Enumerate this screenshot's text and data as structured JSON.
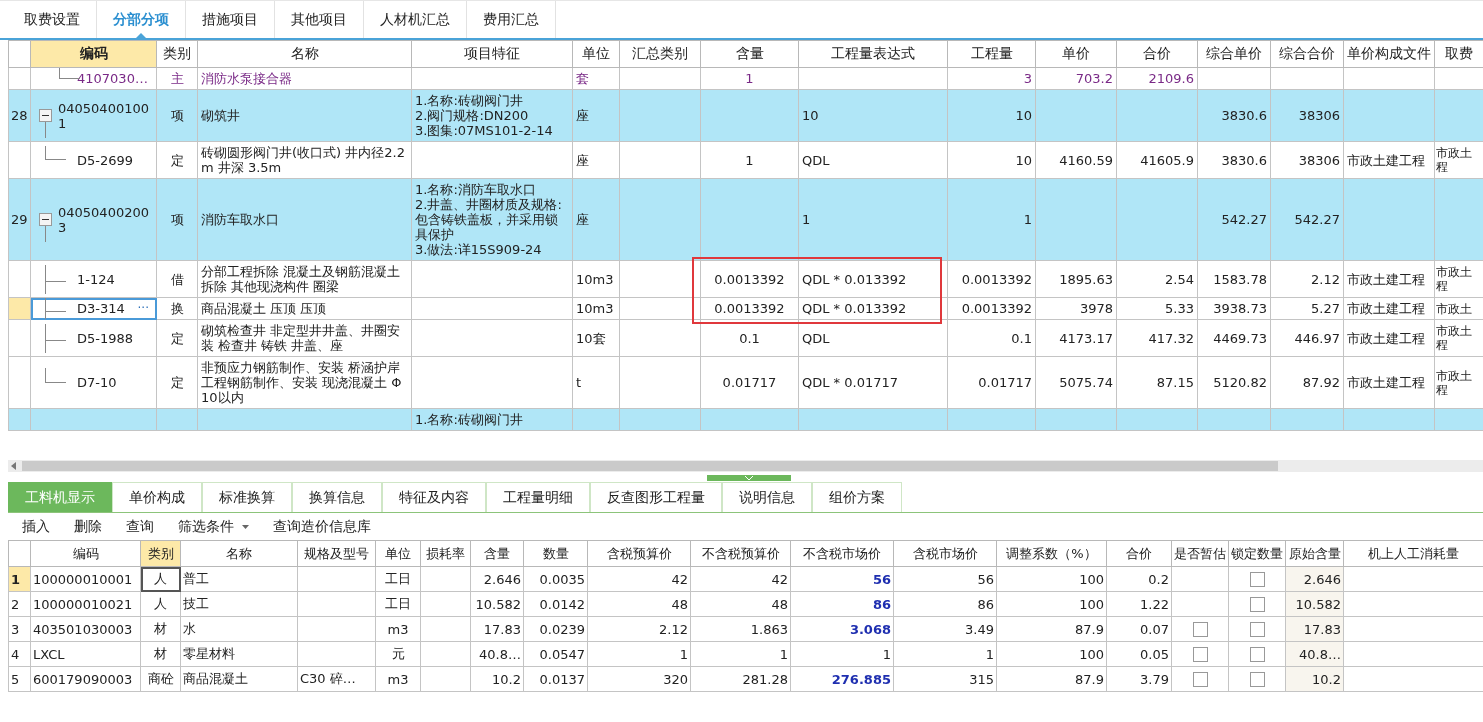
{
  "top_tabs": [
    {
      "label": "取费设置",
      "selected": false
    },
    {
      "label": "分部分项",
      "selected": true
    },
    {
      "label": "措施项目",
      "selected": false
    },
    {
      "label": "其他项目",
      "selected": false
    },
    {
      "label": "人材机汇总",
      "selected": false
    },
    {
      "label": "费用汇总",
      "selected": false
    }
  ],
  "grid": {
    "columns": [
      {
        "label": "编码",
        "selected": true
      },
      {
        "label": "类别",
        "selected": false
      },
      {
        "label": "名称",
        "selected": false
      },
      {
        "label": "项目特征",
        "selected": false
      },
      {
        "label": "单位",
        "selected": false
      },
      {
        "label": "汇总类别",
        "selected": false
      },
      {
        "label": "含量",
        "selected": false
      },
      {
        "label": "工程量表达式",
        "selected": false
      },
      {
        "label": "工程量",
        "selected": false
      },
      {
        "label": "单价",
        "selected": false
      },
      {
        "label": "合价",
        "selected": false
      },
      {
        "label": "综合单价",
        "selected": false
      },
      {
        "label": "综合合价",
        "selected": false
      },
      {
        "label": "单价构成文件",
        "selected": false
      },
      {
        "label": "取费",
        "selected": false
      }
    ],
    "rows": [
      {
        "kind": "material",
        "selected": false,
        "code": "4107030…",
        "type": "主",
        "name": "消防水泵接合器",
        "unit": "套",
        "qty": "1",
        "amount": "3",
        "price": "703.2",
        "total": "2109.6"
      },
      {
        "kind": "item",
        "number": "28",
        "expanded": true,
        "selected": false,
        "code": "040504001001",
        "type": "项",
        "name": "砌筑井",
        "feature": "1.名称:砖砌阀门井\n2.阀门规格:DN200\n3.图集:07MS101-2-14",
        "unit": "座",
        "expr": "10",
        "amount": "10",
        "comp_price": "3830.6",
        "comp_total": "38306",
        "children": [
          {
            "kind": "quota",
            "selected": false,
            "code": "D5-2699",
            "type": "定",
            "name": "砖砌圆形阀门井(收口式) 井内径2.2m 井深 3.5m",
            "unit": "座",
            "qty": "1",
            "expr": "QDL",
            "amount": "10",
            "price": "4160.59",
            "total": "41605.9",
            "comp_price": "3830.6",
            "comp_total": "38306",
            "file": "市政土建工程",
            "fee": "市政土程"
          }
        ]
      },
      {
        "kind": "item",
        "number": "29",
        "expanded": true,
        "selected": false,
        "code": "040504002003",
        "type": "项",
        "name": "消防车取水口",
        "feature": "1.名称:消防车取水口\n2.井盖、井圈材质及规格:包含铸铁盖板，并采用锁具保护\n3.做法:详15S909-24",
        "unit": "座",
        "expr": "1",
        "amount": "1",
        "comp_price": "542.27",
        "comp_total": "542.27",
        "children": [
          {
            "kind": "quota",
            "selected": false,
            "highlighted": true,
            "code": "1-124",
            "type": "借",
            "name": "分部工程拆除 混凝土及钢筋混凝土拆除 其他现浇构件 圈梁",
            "unit": "10m3",
            "qty": "0.0013392",
            "expr": "QDL * 0.013392",
            "amount": "0.0013392",
            "price": "1895.63",
            "total": "2.54",
            "comp_price": "1583.78",
            "comp_total": "2.12",
            "file": "市政土建工程",
            "fee": "市政土程"
          },
          {
            "kind": "quota",
            "selected": true,
            "highlighted": true,
            "code": "D3-314",
            "edit_button": "···",
            "type": "换",
            "name": "商品混凝土 压顶 压顶",
            "unit": "10m3",
            "qty": "0.0013392",
            "expr": "QDL * 0.013392",
            "amount": "0.0013392",
            "price": "3978",
            "total": "5.33",
            "comp_price": "3938.73",
            "comp_total": "5.27",
            "file": "市政土建工程",
            "fee": "市政土"
          },
          {
            "kind": "quota",
            "selected": false,
            "code": "D5-1988",
            "type": "定",
            "name": "砌筑检查井 非定型井井盖、井圈安装 检查井 铸铁 井盖、座",
            "unit": "10套",
            "qty": "0.1",
            "expr": "QDL",
            "amount": "0.1",
            "price": "4173.17",
            "total": "417.32",
            "comp_price": "4469.73",
            "comp_total": "446.97",
            "file": "市政土建工程",
            "fee": "市政土程"
          },
          {
            "kind": "quota",
            "selected": false,
            "code": "D7-10",
            "type": "定",
            "name": "非预应力钢筋制作、安装 桥涵护岸工程钢筋制作、安装 现浇混凝土 Φ10以内",
            "unit": "t",
            "qty": "0.01717",
            "expr": "QDL * 0.01717",
            "amount": "0.01717",
            "price": "5075.74",
            "total": "87.15",
            "comp_price": "5120.82",
            "comp_total": "87.92",
            "file": "市政土建工程",
            "fee": "市政土程"
          }
        ]
      },
      {
        "kind": "item",
        "selected": false,
        "feature": "1.名称:砖砌阀门井"
      }
    ]
  },
  "bottom_tabs": [
    {
      "label": "工料机显示",
      "selected": true
    },
    {
      "label": "单价构成",
      "selected": false
    },
    {
      "label": "标准换算",
      "selected": false
    },
    {
      "label": "换算信息",
      "selected": false
    },
    {
      "label": "特征及内容",
      "selected": false
    },
    {
      "label": "工程量明细",
      "selected": false
    },
    {
      "label": "反查图形工程量",
      "selected": false
    },
    {
      "label": "说明信息",
      "selected": false
    },
    {
      "label": "组价方案",
      "selected": false
    }
  ],
  "toolbar": [
    {
      "label": "插入",
      "dropdown": false
    },
    {
      "label": "删除",
      "dropdown": false
    },
    {
      "label": "查询",
      "dropdown": false
    },
    {
      "label": "筛选条件",
      "dropdown": true
    },
    {
      "label": "查询造价信息库",
      "dropdown": false
    }
  ],
  "resources": {
    "columns": [
      {
        "label": "编码",
        "selected": false
      },
      {
        "label": "类别",
        "selected": true
      },
      {
        "label": "名称",
        "selected": false
      },
      {
        "label": "规格及型号",
        "selected": false
      },
      {
        "label": "单位",
        "selected": false
      },
      {
        "label": "损耗率",
        "selected": false
      },
      {
        "label": "含量",
        "selected": false
      },
      {
        "label": "数量",
        "selected": false
      },
      {
        "label": "含税预算价",
        "selected": false
      },
      {
        "label": "不含税预算价",
        "selected": false
      },
      {
        "label": "不含税市场价",
        "selected": false
      },
      {
        "label": "含税市场价",
        "selected": false
      },
      {
        "label": "调整系数（%）",
        "selected": false
      },
      {
        "label": "合价",
        "selected": false
      },
      {
        "label": "是否暂估",
        "selected": false
      },
      {
        "label": "锁定数量",
        "selected": false
      },
      {
        "label": "原始含量",
        "selected": false
      },
      {
        "label": "机上人工消耗量",
        "selected": false
      }
    ],
    "rows": [
      {
        "number": "1",
        "selected": true,
        "code": "100000010001",
        "type": "人",
        "name": "普工",
        "unit": "工日",
        "qty": "2.646",
        "count": "0.0035",
        "tax_budget": "42",
        "notax_budget": "42",
        "notax_market": "56",
        "price_changed": true,
        "tax_market": "56",
        "factor": "100",
        "total": "0.2",
        "locked": false,
        "original": "2.646"
      },
      {
        "number": "2",
        "selected": false,
        "code": "100000010021",
        "type": "人",
        "name": "技工",
        "unit": "工日",
        "qty": "10.582",
        "count": "0.0142",
        "tax_budget": "48",
        "notax_budget": "48",
        "notax_market": "86",
        "price_changed": true,
        "tax_market": "86",
        "factor": "100",
        "total": "1.22",
        "locked": false,
        "original": "10.582"
      },
      {
        "number": "3",
        "selected": false,
        "code": "403501030003",
        "type": "材",
        "name": "水",
        "unit": "m3",
        "qty": "17.83",
        "count": "0.0239",
        "tax_budget": "2.12",
        "notax_budget": "1.863",
        "notax_market": "3.068",
        "price_changed": true,
        "tax_market": "3.49",
        "factor": "87.9",
        "total": "0.07",
        "provisional": false,
        "locked": false,
        "original": "17.83"
      },
      {
        "number": "4",
        "selected": false,
        "code": "LXCL",
        "type": "材",
        "name": "零星材料",
        "unit": "元",
        "qty": "40.8…",
        "count": "0.0547",
        "tax_budget": "1",
        "notax_budget": "1",
        "notax_market": "1",
        "price_changed": false,
        "tax_market": "1",
        "factor": "100",
        "total": "0.05",
        "provisional": false,
        "locked": false,
        "original": "40.8…"
      },
      {
        "number": "5",
        "selected": false,
        "code": "600179090003",
        "type": "商砼",
        "name": "商品混凝土",
        "spec": "C30 碎…",
        "unit": "m3",
        "qty": "10.2",
        "count": "0.0137",
        "tax_budget": "320",
        "notax_budget": "281.28",
        "notax_market": "276.885",
        "price_changed": true,
        "tax_market": "315",
        "factor": "87.9",
        "total": "3.79",
        "provisional": false,
        "locked": false,
        "original": "10.2"
      }
    ]
  }
}
